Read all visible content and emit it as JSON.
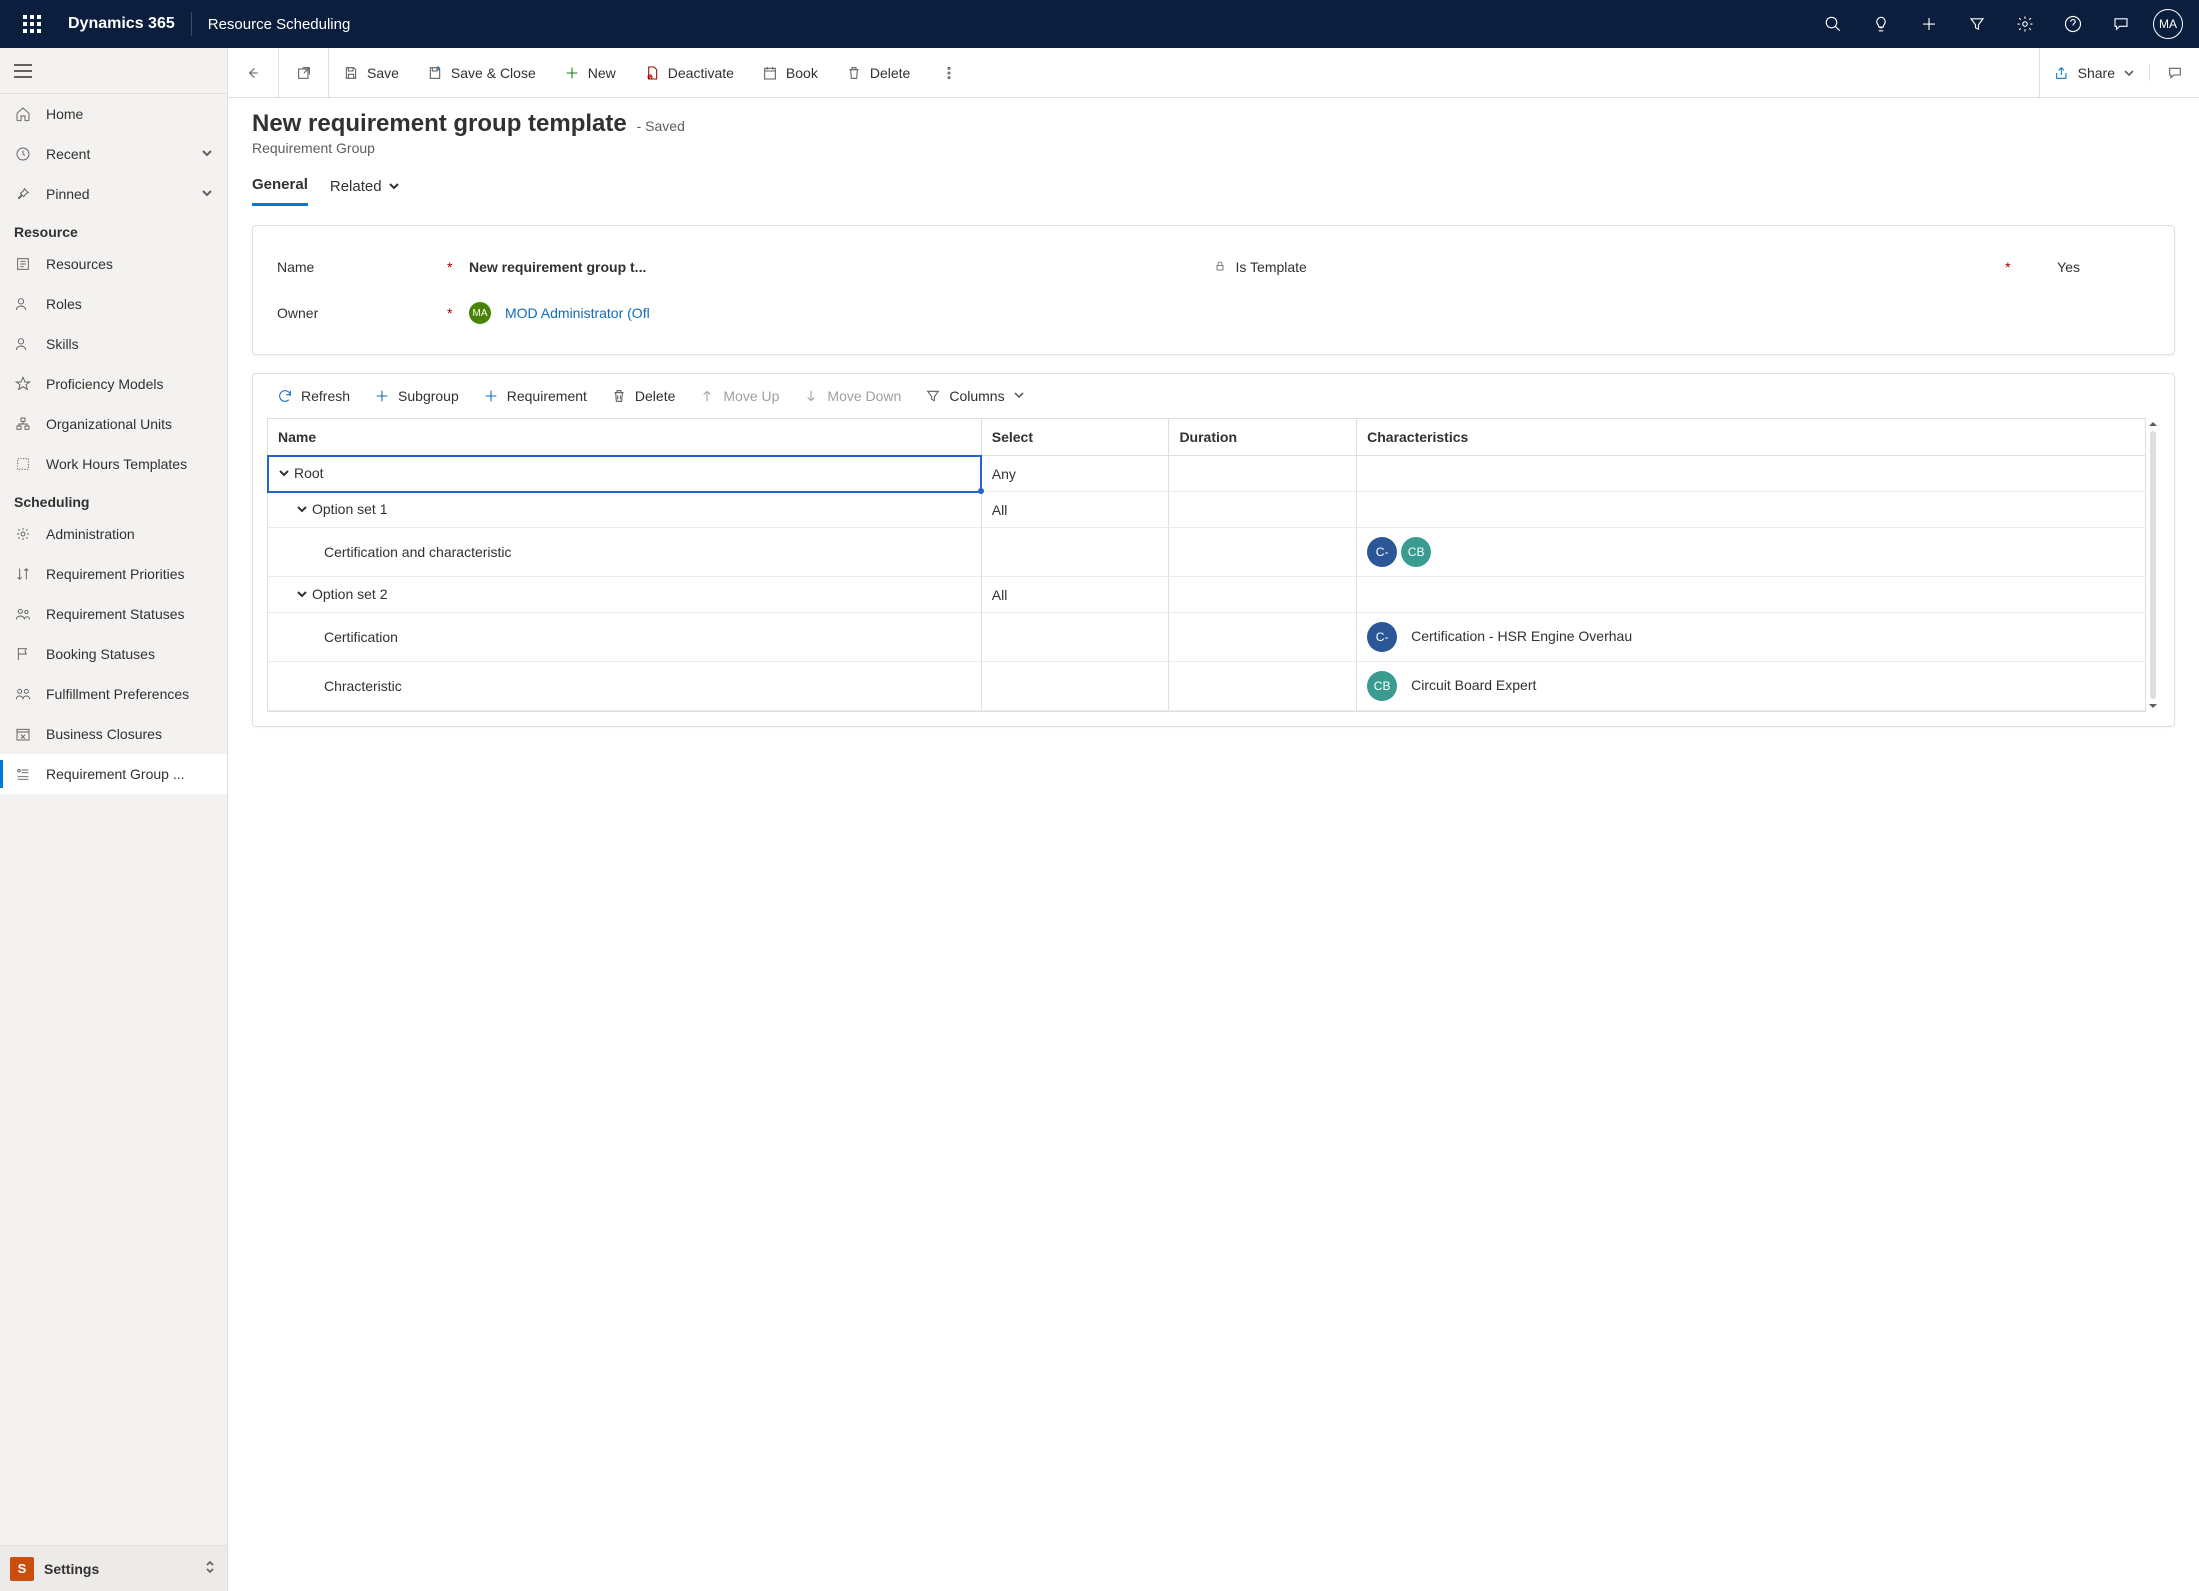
{
  "topbar": {
    "brand": "Dynamics 365",
    "app": "Resource Scheduling",
    "avatar": "MA"
  },
  "leftnav": {
    "home": "Home",
    "recent": "Recent",
    "pinned": "Pinned",
    "section_resource": "Resource",
    "resources": "Resources",
    "roles": "Roles",
    "skills": "Skills",
    "proficiency": "Proficiency Models",
    "org_units": "Organizational Units",
    "work_hours": "Work Hours Templates",
    "section_scheduling": "Scheduling",
    "administration": "Administration",
    "req_priorities": "Requirement Priorities",
    "req_statuses": "Requirement Statuses",
    "booking_statuses": "Booking Statuses",
    "fulfillment": "Fulfillment Preferences",
    "business_closures": "Business Closures",
    "req_group": "Requirement Group ...",
    "area_badge": "S",
    "area_label": "Settings"
  },
  "commandbar": {
    "save": "Save",
    "save_close": "Save & Close",
    "new": "New",
    "deactivate": "Deactivate",
    "book": "Book",
    "delete": "Delete",
    "share": "Share"
  },
  "header": {
    "title": "New requirement group template",
    "suffix": "- Saved",
    "entity": "Requirement Group"
  },
  "tabs": {
    "general": "General",
    "related": "Related"
  },
  "form": {
    "name_label": "Name",
    "name_value": "New requirement group t...",
    "template_label": "Is Template",
    "template_value": "Yes",
    "owner_label": "Owner",
    "owner_value": "MOD Administrator (Ofl",
    "owner_initials": "MA"
  },
  "subtoolbar": {
    "refresh": "Refresh",
    "subgroup": "Subgroup",
    "requirement": "Requirement",
    "delete": "Delete",
    "move_up": "Move Up",
    "move_down": "Move Down",
    "columns": "Columns"
  },
  "grid": {
    "headers": {
      "name": "Name",
      "select": "Select",
      "duration": "Duration",
      "characteristics": "Characteristics"
    },
    "rows": [
      {
        "name": "Root",
        "select": "Any",
        "duration": "",
        "char_chips": [],
        "char_text": "",
        "indent": 0,
        "expandable": true,
        "selected": true
      },
      {
        "name": "Option set 1",
        "select": "All",
        "duration": "",
        "char_chips": [],
        "char_text": "",
        "indent": 1,
        "expandable": true
      },
      {
        "name": "Certification and characteristic",
        "select": "",
        "duration": "",
        "char_chips": [
          "C-",
          "CB"
        ],
        "char_text": "",
        "indent": 2,
        "expandable": false
      },
      {
        "name": "Option set 2",
        "select": "All",
        "duration": "",
        "char_chips": [],
        "char_text": "",
        "indent": 1,
        "expandable": true
      },
      {
        "name": "Certification",
        "select": "",
        "duration": "",
        "char_chips": [
          "C-"
        ],
        "char_text": "Certification - HSR Engine Overhau",
        "indent": 2,
        "expandable": false
      },
      {
        "name": "Chracteristic",
        "select": "",
        "duration": "",
        "char_chips": [
          "CB"
        ],
        "char_text": "Circuit Board Expert",
        "indent": 2,
        "expandable": false
      }
    ]
  }
}
